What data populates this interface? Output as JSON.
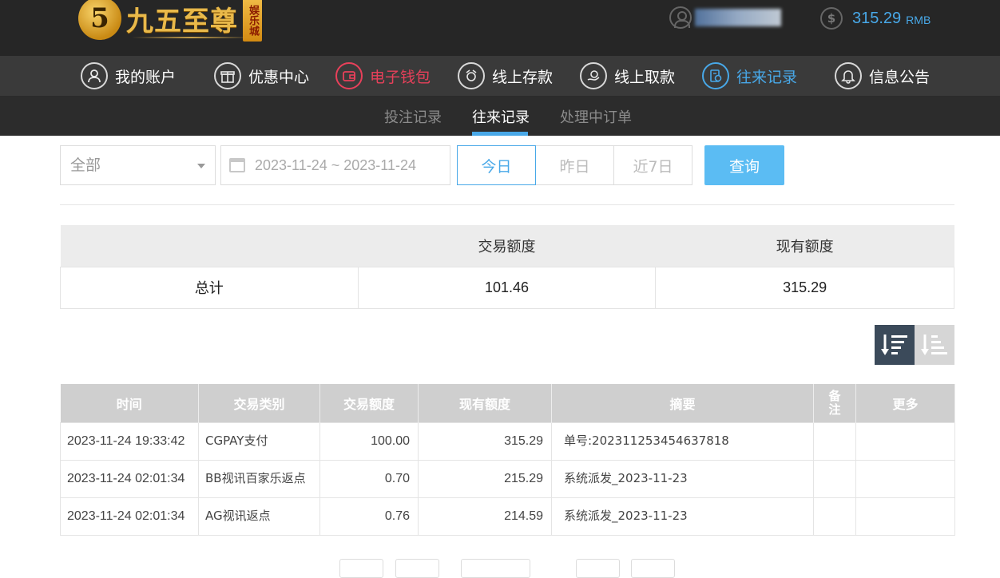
{
  "header": {
    "logo_mark": "5",
    "logo_text": "九五至尊",
    "logo_badge": "娱乐城",
    "balance_amount": "315.29",
    "balance_unit": "RMB"
  },
  "nav": [
    {
      "label": "我的账户",
      "icon": "user-icon"
    },
    {
      "label": "优惠中心",
      "icon": "gift-icon"
    },
    {
      "label": "电子钱包",
      "icon": "wallet-icon"
    },
    {
      "label": "线上存款",
      "icon": "deposit-icon"
    },
    {
      "label": "线上取款",
      "icon": "withdraw-icon"
    },
    {
      "label": "往来记录",
      "icon": "records-icon"
    },
    {
      "label": "信息公告",
      "icon": "bell-icon"
    }
  ],
  "subnav": [
    {
      "label": "投注记录"
    },
    {
      "label": "往来记录"
    },
    {
      "label": "处理中订单"
    }
  ],
  "filter": {
    "type_value": "全部",
    "date_range": "2023-11-24 ~ 2023-11-24",
    "ranges": [
      "今日",
      "昨日",
      "近7日"
    ],
    "query_label": "查询"
  },
  "summary": {
    "headers": [
      "",
      "交易额度",
      "现有额度"
    ],
    "row_label": "总计",
    "trade_amount": "101.46",
    "current_amount": "315.29"
  },
  "records": {
    "headers": [
      "时间",
      "交易类别",
      "交易额度",
      "现有额度",
      "摘要",
      "备注",
      "更多"
    ],
    "rows": [
      {
        "time": "2023-11-24 19:33:42",
        "type": "CGPAY支付",
        "amount": "100.00",
        "balance": "315.29",
        "memo": "单号:202311253454637818"
      },
      {
        "time": "2023-11-24 02:01:34",
        "type": "BB视讯百家乐返点",
        "amount": "0.70",
        "balance": "215.29",
        "memo": "系统派发_2023-11-23"
      },
      {
        "time": "2023-11-24 02:01:34",
        "type": "AG视讯返点",
        "amount": "0.76",
        "balance": "214.59",
        "memo": "系统派发_2023-11-23"
      }
    ]
  },
  "colors": {
    "accent_blue": "#48a8e8",
    "accent_red": "#e8405a",
    "header_bg": "#262626",
    "nav_bg": "#3a3a3a"
  }
}
